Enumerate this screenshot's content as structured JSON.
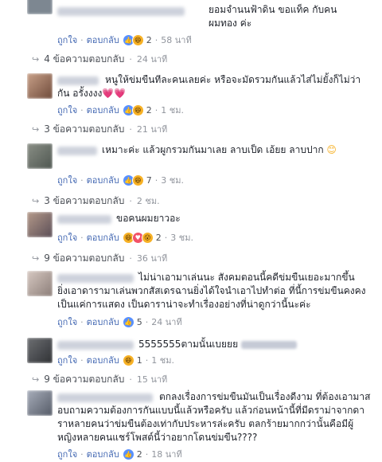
{
  "icons": {
    "like": "like-icon",
    "haha": "haha-icon",
    "love": "love-icon",
    "wow": "wow-icon"
  },
  "colors": {
    "link": "#4267b2",
    "meta": "#90949c",
    "text": "#1d2129",
    "like": "#5890ff",
    "haha": "#f7b125",
    "love": "#f25268"
  },
  "comments": [
    {
      "text": "ยอมจำนนฟ้าดิน ขอแท็ค กับคน\nผมทอง ค่ะ",
      "like": "ถูกใจ",
      "reply": "ตอบกลับ",
      "react_count": "2",
      "time": "58 นาที",
      "replies_label": "4 ข้อความตอบกลับ",
      "replies_time": "24 นาที"
    },
    {
      "text": "หนูให้ข่มขืนทีละคนเลยค่ะ หรือจะมัดรวมกันแล้วไส่ไม่ยั้งก็ไม่ว่า\nกัน อรั้งงงง",
      "hearts": "💗💗",
      "like": "ถูกใจ",
      "reply": "ตอบกลับ",
      "react_count": "2",
      "time": "1 ชม.",
      "replies_label": "3 ข้อความตอบกลับ",
      "replies_time": "21 นาที"
    },
    {
      "text": "เหมาะค่ะ แล้วผูกรวมกันมาเลย ลาบเป็ด เอ้ยย ลาบปาก",
      "emoji": "😊",
      "like": "ถูกใจ",
      "reply": "ตอบกลับ",
      "react_count": "7",
      "time": "3 ชม.",
      "replies_label": "3 ข้อความตอบกลับ",
      "replies_time": "2 ชม."
    },
    {
      "text": "ขอคนผมยาวอะ",
      "like": "ถูกใจ",
      "reply": "ตอบกลับ",
      "react_count": "2",
      "time": "3 ชม.",
      "replies_label": "9 ข้อความตอบกลับ",
      "replies_time": "36 นาที"
    },
    {
      "text": "ไม่น่าเอามาเล่นนะ สังคมตอนนี้คดีข่มขืนเยอะมากขึ้น\nยิ่งเอาดารามาเล่นพวกสัสเดรฉานยิ่งได้ใจนำเอาไปทำต่อ ที่นี้การข่มขืนคงคง\nเป็นแค่การแสดง เป็นดาราน่าจะทำเรื่องอย่างที่น่าดูกว่านี้นะค่ะ",
      "like": "ถูกใจ",
      "reply": "ตอบกลับ",
      "react_count": "5",
      "time": "24 นาที"
    },
    {
      "text": "5555555ตามนั้นเบยยย",
      "like": "ถูกใจ",
      "reply": "ตอบกลับ",
      "react_count": "1",
      "time": "1 ชม.",
      "replies_label": "9 ข้อความตอบกลับ",
      "replies_time": "15 นาที"
    },
    {
      "text": "ตกลงเรื่องการข่มขืนมันเป็นเรื่องดีงาม ที่ต้องเอามาส\nอบถามความต้องการกันแบบนี้แล้วหรือครับ แล้วก่อนหน้านี้ที่มีดราม่าจากดา\nราหลายคนว่าข่มขืนต้องเท่ากับประหารล่ะครับ ตลกร้ายมากกว่านั้นคือมีผู้\nหญิงหลายคนแชร์โพสต์นี้ว่าอยากโดนข่มขืน????",
      "like": "ถูกใจ",
      "reply": "ตอบกลับ",
      "react_count": "2",
      "time": "18 นาที"
    }
  ]
}
